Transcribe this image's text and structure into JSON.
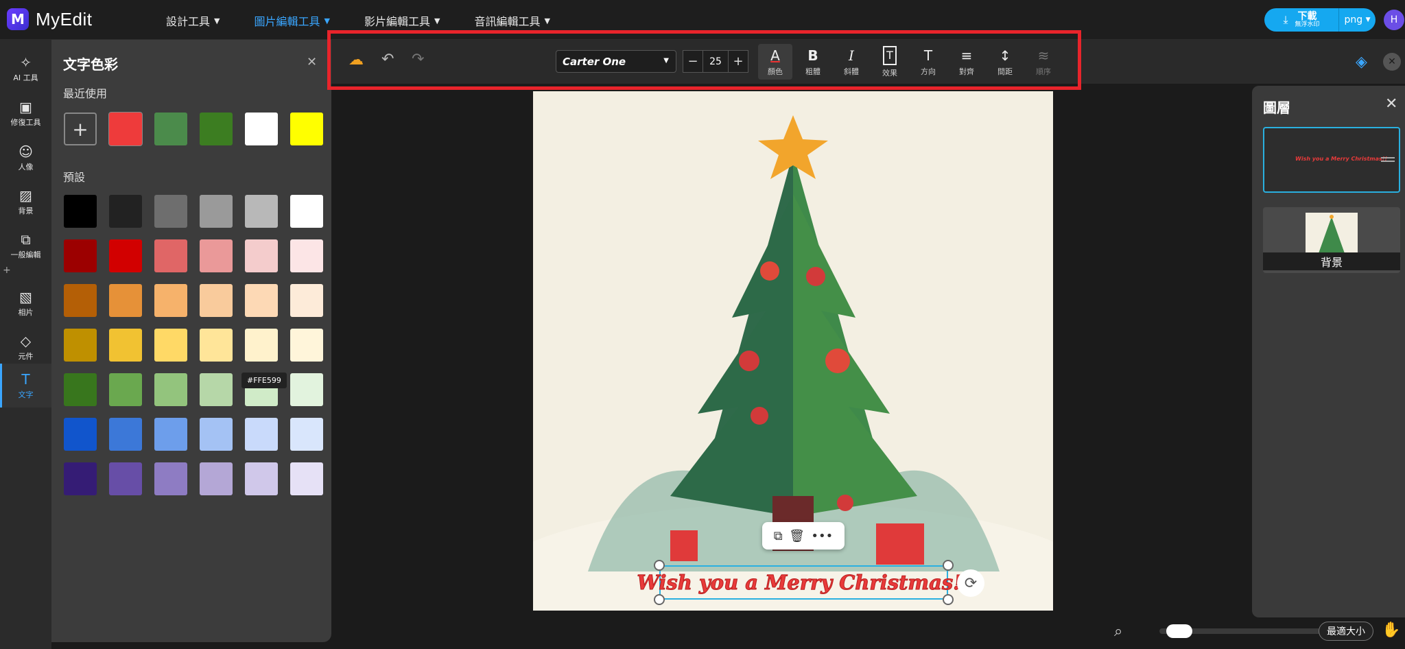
{
  "app": {
    "name": "MyEdit",
    "logo_letter": "M"
  },
  "nav": [
    {
      "label": "設計工具",
      "active": false
    },
    {
      "label": "圖片編輯工具",
      "active": true
    },
    {
      "label": "影片編輯工具",
      "active": false
    },
    {
      "label": "音訊編輯工具",
      "active": false
    }
  ],
  "download": {
    "label": "下載",
    "sub": "無浮水印",
    "format": "png"
  },
  "user": {
    "initial": "H"
  },
  "rail": [
    {
      "label": "AI 工具",
      "icon": "magic-wand-icon"
    },
    {
      "label": "修復工具",
      "icon": "image-repair-icon"
    },
    {
      "label": "人像",
      "icon": "portrait-icon"
    },
    {
      "label": "背景",
      "icon": "background-icon"
    },
    {
      "label": "一般編輯",
      "icon": "crop-icon"
    },
    {
      "label": "相片",
      "icon": "photo-icon"
    },
    {
      "label": "元件",
      "icon": "shapes-icon"
    },
    {
      "label": "文字",
      "icon": "text-icon",
      "active": true
    }
  ],
  "panel": {
    "title": "文字色彩",
    "recent_label": "最近使用",
    "preset_label": "預設",
    "recent_colors": [
      "#ee3b3b",
      "#4b8b4b",
      "#3c7d21",
      "#ffffff",
      "#ffff00"
    ],
    "preset_colors": [
      [
        "#000000",
        "#222222",
        "#6e6e6e",
        "#9a9a9a",
        "#b8b8b8",
        "#ffffff"
      ],
      [
        "#9c0000",
        "#d20000",
        "#e06666",
        "#ea9999",
        "#f4cccc",
        "#fce5e6"
      ],
      [
        "#b45f06",
        "#e69138",
        "#f6b26b",
        "#f9cb9c",
        "#fdd9b5",
        "#fdebd9"
      ],
      [
        "#bf9000",
        "#f1c232",
        "#ffd966",
        "#ffe599",
        "#fff2cc",
        "#fff5da"
      ],
      [
        "#38761d",
        "#6aa84f",
        "#93c47d",
        "#b6d7a8",
        "#d0ebc8",
        "#e2f3de"
      ],
      [
        "#1155cc",
        "#3c78d8",
        "#6d9eeb",
        "#a4c2f4",
        "#c9dafb",
        "#d9e6fc"
      ],
      [
        "#351c75",
        "#674ea7",
        "#8e7cc3",
        "#b4a7d6",
        "#d0c8ea",
        "#e6e1f6"
      ]
    ],
    "tooltip": "#FFE599"
  },
  "toolbar": {
    "font": "Carter One",
    "size": "25",
    "minus": "−",
    "plus": "+",
    "tools": [
      {
        "label": "顏色",
        "glyph": "A",
        "active": true
      },
      {
        "label": "粗體",
        "glyph": "B"
      },
      {
        "label": "斜體",
        "glyph": "I"
      },
      {
        "label": "效果",
        "glyph": "T"
      },
      {
        "label": "方向",
        "glyph": "T"
      },
      {
        "label": "對齊",
        "glyph": "≡"
      },
      {
        "label": "間距",
        "glyph": "↕"
      },
      {
        "label": "順序",
        "glyph": "≋",
        "disabled": true
      }
    ]
  },
  "canvas": {
    "text": "Wish you a Merry Christmas!!"
  },
  "layers": {
    "title": "圖層",
    "items": [
      {
        "preview_text": "Wish you a Merry Christmas!!"
      },
      {
        "label": "背景"
      }
    ]
  },
  "bottom": {
    "fit_label": "最適大小",
    "zoom": 0.05
  }
}
